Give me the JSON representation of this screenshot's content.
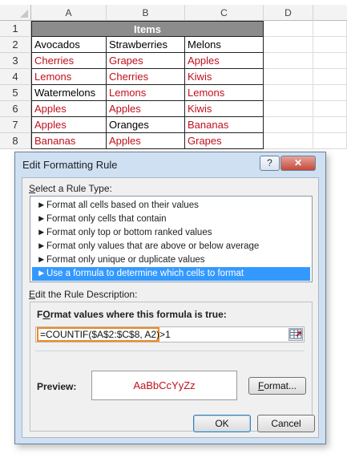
{
  "spreadsheet": {
    "column_headers": [
      "A",
      "B",
      "C",
      "D"
    ],
    "row_numbers": [
      "1",
      "2",
      "3",
      "4",
      "5",
      "6",
      "7",
      "8"
    ],
    "header_cell": "Items",
    "rows": [
      [
        {
          "text": "Avocados",
          "hl": false
        },
        {
          "text": "Strawberries",
          "hl": false
        },
        {
          "text": "Melons",
          "hl": false
        }
      ],
      [
        {
          "text": "Cherries",
          "hl": true
        },
        {
          "text": "Grapes",
          "hl": true
        },
        {
          "text": "Apples",
          "hl": true
        }
      ],
      [
        {
          "text": "Lemons",
          "hl": true
        },
        {
          "text": "Cherries",
          "hl": true
        },
        {
          "text": "Kiwis",
          "hl": true
        }
      ],
      [
        {
          "text": "Watermelons",
          "hl": false
        },
        {
          "text": "Lemons",
          "hl": true
        },
        {
          "text": "Lemons",
          "hl": true
        }
      ],
      [
        {
          "text": "Apples",
          "hl": true
        },
        {
          "text": "Apples",
          "hl": true
        },
        {
          "text": "Kiwis",
          "hl": true
        }
      ],
      [
        {
          "text": "Apples",
          "hl": true
        },
        {
          "text": "Oranges",
          "hl": false
        },
        {
          "text": "Bananas",
          "hl": true
        }
      ],
      [
        {
          "text": "Bananas",
          "hl": true
        },
        {
          "text": "Apples",
          "hl": true
        },
        {
          "text": "Grapes",
          "hl": true
        }
      ]
    ],
    "highlight_color": "#c0101c",
    "header_fill": "#8c8c8c"
  },
  "dialog": {
    "title": "Edit Formatting Rule",
    "help_label": "?",
    "close_label": "✕",
    "rule_type_section": {
      "key": "S",
      "rest": "elect a Rule Type:"
    },
    "rule_types": [
      {
        "label": "Format all cells based on their values",
        "selected": false
      },
      {
        "label": "Format only cells that contain",
        "selected": false
      },
      {
        "label": "Format only top or bottom ranked values",
        "selected": false
      },
      {
        "label": "Format only values that are above or below average",
        "selected": false
      },
      {
        "label": "Format only unique or duplicate values",
        "selected": false
      },
      {
        "label": "Use a formula to determine which cells to format",
        "selected": true
      }
    ],
    "rule_arrow": "►",
    "description_section": {
      "key": "E",
      "rest": "dit the Rule Description:"
    },
    "formula_label": {
      "key": "O",
      "pre": "F",
      "rest": "rmat values where this formula is true:"
    },
    "formula_value": "=COUNTIF($A$2:$C$8, A2)>1",
    "preview_label": "Preview:",
    "preview_sample": "AaBbCcYyZz",
    "format_button": {
      "key": "F",
      "rest": "ormat..."
    },
    "ok_label": "OK",
    "cancel_label": "Cancel",
    "selection_color": "#3399ff",
    "focus_color": "#f08a22"
  }
}
